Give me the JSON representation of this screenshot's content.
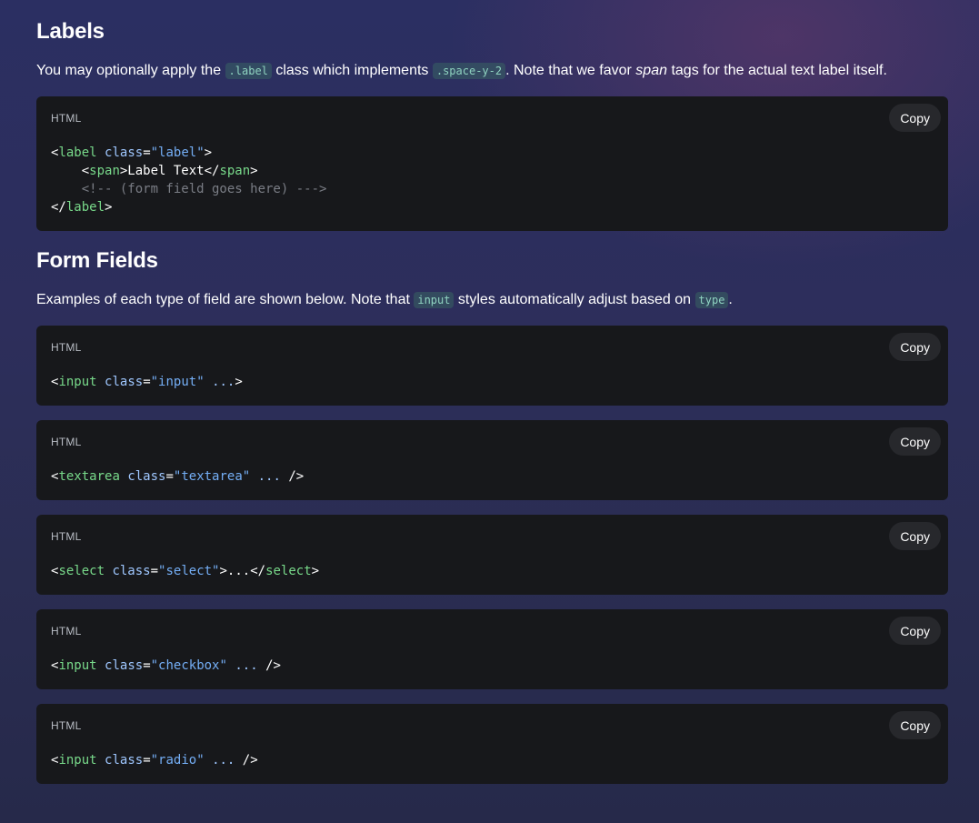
{
  "labels_section": {
    "heading": "Labels",
    "desc_1": "You may optionally apply the ",
    "desc_code_1": ".label",
    "desc_2": " class which implements ",
    "desc_code_2": ".space-y-2",
    "desc_3": ". Note that we favor ",
    "desc_em": "span",
    "desc_4": " tags for the actual text label itself.",
    "code_block": {
      "lang": "HTML",
      "copy": "Copy",
      "lines": [
        [
          "<",
          "label",
          " ",
          "class",
          "=",
          "\"label\"",
          ">"
        ],
        [
          "    <",
          "span",
          ">Label Text</",
          "span",
          ">"
        ],
        [
          "    <!-- (form field goes here) --->"
        ],
        [
          "</",
          "label",
          ">"
        ]
      ]
    }
  },
  "form_section": {
    "heading": "Form Fields",
    "desc_1": "Examples of each type of field are shown below. Note that ",
    "desc_code_1": "input",
    "desc_2": " styles automatically adjust based on ",
    "desc_code_2": "type",
    "desc_3": ".",
    "blocks": [
      {
        "lang": "HTML",
        "copy": "Copy",
        "tag": "input",
        "attr": "class",
        "value": "\"input\"",
        "rest": " ...",
        "close": ">"
      },
      {
        "lang": "HTML",
        "copy": "Copy",
        "tag": "textarea",
        "attr": "class",
        "value": "\"textarea\"",
        "rest": " ...",
        "close": " />"
      },
      {
        "lang": "HTML",
        "copy": "Copy",
        "tag": "select",
        "attr": "class",
        "value": "\"select\"",
        "rest": ">...</",
        "close_tag": "select",
        "close": ">"
      },
      {
        "lang": "HTML",
        "copy": "Copy",
        "tag": "input",
        "attr": "class",
        "value": "\"checkbox\"",
        "rest": " ...",
        "close": " />"
      },
      {
        "lang": "HTML",
        "copy": "Copy",
        "tag": "input",
        "attr": "class",
        "value": "\"radio\"",
        "rest": " ...",
        "close": " />"
      }
    ]
  },
  "colors": {
    "tag": "#78d98a",
    "attribute": "#9fc7ff",
    "string": "#74aef5",
    "comment": "#7a7d85",
    "code_bg": "#17181b"
  }
}
